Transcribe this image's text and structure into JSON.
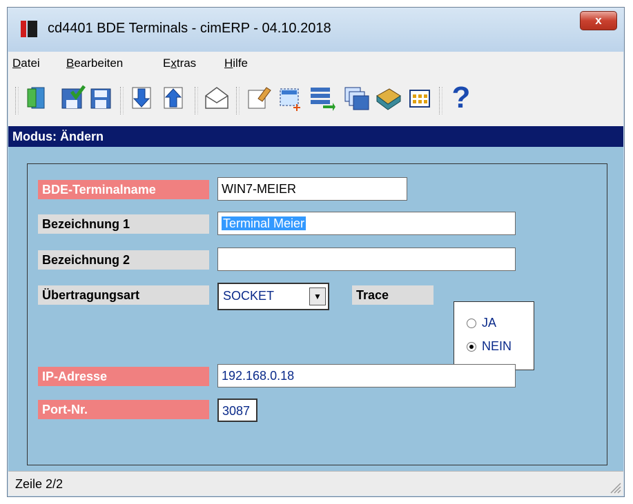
{
  "window": {
    "title": "cd4401 BDE Terminals - cimERP - 04.10.2018",
    "close_label": "x"
  },
  "menu": [
    {
      "pre": "",
      "u": "D",
      "post": "atei"
    },
    {
      "pre": "",
      "u": "B",
      "post": "earbeiten"
    },
    {
      "pre": "E",
      "u": "x",
      "post": "tras"
    },
    {
      "pre": "",
      "u": "H",
      "post": "ilfe"
    }
  ],
  "toolbar": {
    "icons": [
      "exit-door-icon",
      "save-check-icon",
      "save-icon",
      "arrow-down-icon",
      "arrow-up-icon",
      "envelope-icon",
      "edit-document-icon",
      "new-record-icon",
      "list-transfer-icon",
      "windows-icon",
      "book-icon",
      "grid-icon",
      "help-icon"
    ],
    "help_label": "?"
  },
  "mode": "Modus: Ändern",
  "form": {
    "terminalname": {
      "label": "BDE-Terminalname",
      "value": "WIN7-MEIER"
    },
    "bezeichnung1": {
      "label": "Bezeichnung 1",
      "value": "Terminal Meier"
    },
    "bezeichnung2": {
      "label": "Bezeichnung 2",
      "value": ""
    },
    "uebertragungsart": {
      "label": "Übertragungsart",
      "value": "SOCKET",
      "arrow": "▼"
    },
    "trace": {
      "label": "Trace",
      "options": [
        "JA",
        "NEIN"
      ],
      "selected": "NEIN"
    },
    "ip": {
      "label": "IP-Adresse",
      "value": "192.168.0.18"
    },
    "port": {
      "label": "Port-Nr.",
      "value": "3087"
    }
  },
  "status": "Zeile 2/2",
  "colors": {
    "mode_bar": "#0a1a6b",
    "content_bg": "#98c2dc",
    "required_label": "#f08080",
    "optional_label": "#dcdcdc"
  }
}
